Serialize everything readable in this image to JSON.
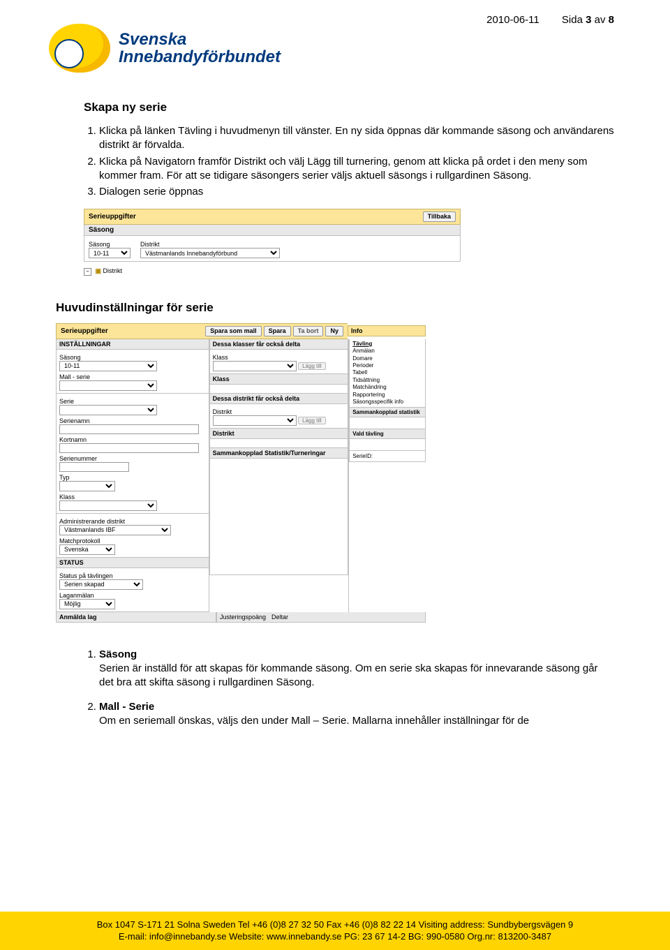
{
  "header": {
    "date": "2010-06-11",
    "page_label": "Sida",
    "page_num": "3",
    "page_of": "av",
    "page_total": "8",
    "org_line1": "Svenska",
    "org_line2": "Innebandyförbundet"
  },
  "section1": {
    "title": "Skapa ny serie",
    "items": [
      "Klicka på länken Tävling i huvudmenyn till vänster. En ny sida öppnas där kommande säsong och användarens distrikt är förvalda.",
      "Klicka på Navigatorn framför Distrikt och välj Lägg till turnering, genom att klicka på ordet i den meny som kommer fram. För att se tidigare säsongers serier väljs aktuell säsongs i rullgardinen Säsong.",
      "Dialogen serie öppnas"
    ]
  },
  "shot1": {
    "bar_title": "Serieuppgifter",
    "back_btn": "Tillbaka",
    "sasong_bar": "Säsong",
    "lbl_sasong": "Säsong",
    "lbl_distrikt": "Distrikt",
    "sel_sasong": "10-11",
    "sel_distrikt": "Västmanlands Innebandyförbund",
    "dist_footer": "Distrikt"
  },
  "section2": {
    "title": "Huvudinställningar för serie"
  },
  "shot2": {
    "bar_title": "Serieuppgifter",
    "btn_spara_mall": "Spara som mall",
    "btn_spara": "Spara",
    "btn_tabort": "Ta bort",
    "btn_ny": "Ny",
    "hdr_inst": "INSTÄLLNINGAR",
    "hdr_klasser": "Dessa klasser får också delta",
    "hdr_info": "Info",
    "info_tavling": "Tävling",
    "info_items": [
      "Anmälan",
      "Domare",
      "Perioder",
      "Tabell",
      "Tidsättning",
      "Matchändring",
      "Rapportering",
      "Säsongsspecifik info"
    ],
    "info_stat": "Sammankopplad statistik",
    "info_vald": "Vald tävling",
    "info_serieid": "SerieID:",
    "lbl_sasong": "Säsong",
    "sel_sasong": "10-11",
    "lbl_mall": "Mall - serie",
    "lbl_serie": "Serie",
    "lbl_serienamn": "Serienamn",
    "lbl_kortnamn": "Kortnamn",
    "lbl_serienummer": "Serienummer",
    "lbl_typ": "Typ",
    "lbl_klass2": "Klass",
    "lbl_admin": "Administrerande distrikt",
    "sel_admin": "Västmanlands IBF",
    "lbl_matchp": "Matchprotokoll",
    "sel_matchp": "Svenska",
    "mid_klass_lbl": "Klass",
    "mid_lagg": "Lägg till",
    "mid_klass_hdr": "Klass",
    "mid_dist_hdr": "Dessa distrikt får också delta",
    "mid_dist_lbl": "Distrikt",
    "mid_dist_bar": "Distrikt",
    "mid_stat_bar": "Sammankopplad Statistik/Turneringar",
    "status_hdr": "STATUS",
    "status_lbl1": "Status på tävlingen",
    "status_sel1": "Serien skapad",
    "status_lbl2": "Laganmälan",
    "status_sel2": "Möjlig",
    "anm_hdr": "Anmälda lag",
    "anm_col1": "Justeringspoäng",
    "anm_col2": "Deltar"
  },
  "section3": {
    "items": [
      {
        "t": "Säsong",
        "body": "Serien är inställd för att skapas för kommande säsong. Om en serie ska skapas för innevarande säsong går det bra att skifta säsong i rullgardinen Säsong."
      },
      {
        "t": "Mall - Serie",
        "body": "Om en seriemall önskas, väljs den under Mall – Serie. Mallarna innehåller inställningar för de"
      }
    ]
  },
  "footer": {
    "line1": "Box 1047 S-171 21 Solna Sweden  Tel +46 (0)8 27 32 50 Fax +46 (0)8 82 22 14 Visiting address: Sundbybergsvägen 9",
    "line2": "E-mail: info@innebandy.se Website: www.innebandy.se  PG: 23 67 14-2 BG: 990-0580 Org.nr: 813200-3487"
  }
}
